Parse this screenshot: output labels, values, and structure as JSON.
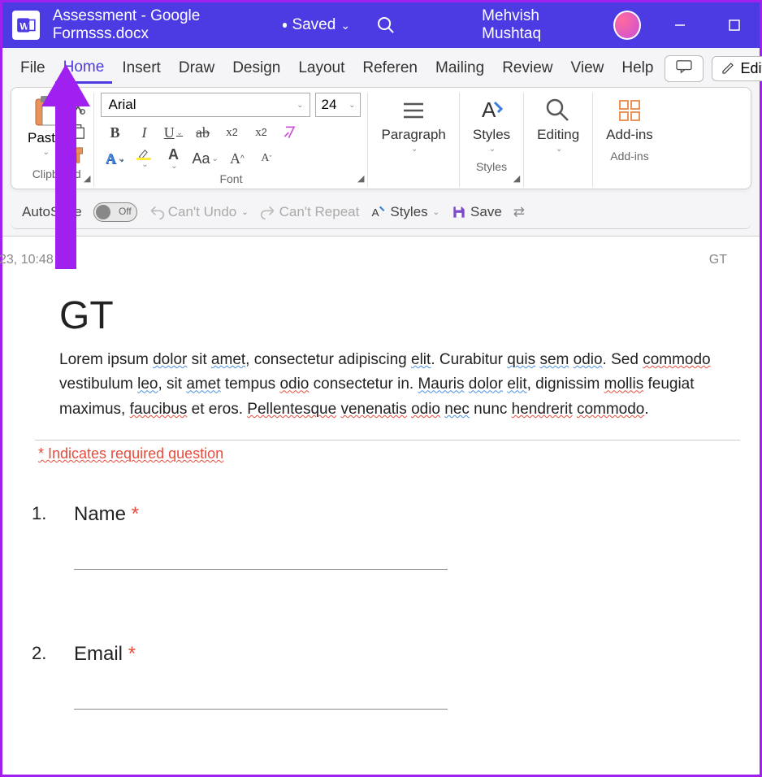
{
  "titlebar": {
    "filename": "Assessment - Google Formsss.docx",
    "status": "Saved",
    "user": "Mehvish Mushtaq"
  },
  "tabs": {
    "file": "File",
    "home": "Home",
    "insert": "Insert",
    "draw": "Draw",
    "design": "Design",
    "layout": "Layout",
    "references": "Referen",
    "mailings": "Mailing",
    "review": "Review",
    "view": "View",
    "help": "Help",
    "editing": "Editing"
  },
  "ribbon": {
    "clipboard": {
      "paste": "Paste",
      "label": "Clipboard"
    },
    "font": {
      "name": "Arial",
      "size": "24",
      "label": "Font",
      "case": "Aa"
    },
    "paragraph": {
      "label": "Paragraph"
    },
    "styles": {
      "label": "Styles"
    },
    "editing": {
      "label": "Editing"
    },
    "addins": {
      "label": "Add-ins"
    }
  },
  "qat": {
    "autosave": "AutoSave",
    "off": "Off",
    "undo": "Can't Undo",
    "redo": "Can't Repeat",
    "styles": "Styles",
    "save": "Save"
  },
  "page": {
    "header_left": "23, 10:48 AM",
    "header_right": "GT",
    "title": "GT",
    "para_parts": {
      "p1": "Lorem ipsum ",
      "w1": "dolor",
      "p2": " sit ",
      "w2": "amet",
      "p3": ", consectetur adipiscing ",
      "w3": "elit",
      "p4": ". Curabitur ",
      "w4": "quis",
      "p5": " ",
      "w5": "sem",
      "p6": " ",
      "w6": "odio",
      "p7": ". Sed ",
      "w7": "commodo",
      "p8": " vestibulum ",
      "w8": "leo",
      "p9": ", sit ",
      "w9": "amet",
      "p10": " tempus ",
      "w10": "odio",
      "p11": " consectetur in. ",
      "w11": "Mauris",
      "p12": " ",
      "w12": "dolor",
      "p13": " ",
      "w13": "elit",
      "p14": ", dignissim ",
      "w14": "mollis",
      "p15": " feugiat maximus, ",
      "w15": "faucibus",
      "p16": " et eros. ",
      "w16": "Pellentesque",
      "p17": " ",
      "w17": "venenatis",
      "p18": " ",
      "w18": "odio",
      "p19": " ",
      "w19": "nec",
      "p20": " nunc ",
      "w20": "hendrerit",
      "p21": " ",
      "w21": "commodo",
      "p22": "."
    },
    "required_note": "* Indicates required question",
    "q1": {
      "num": "1.",
      "label": "Name ",
      "star": "*"
    },
    "q2": {
      "num": "2.",
      "label": "Email ",
      "star": "*"
    }
  }
}
